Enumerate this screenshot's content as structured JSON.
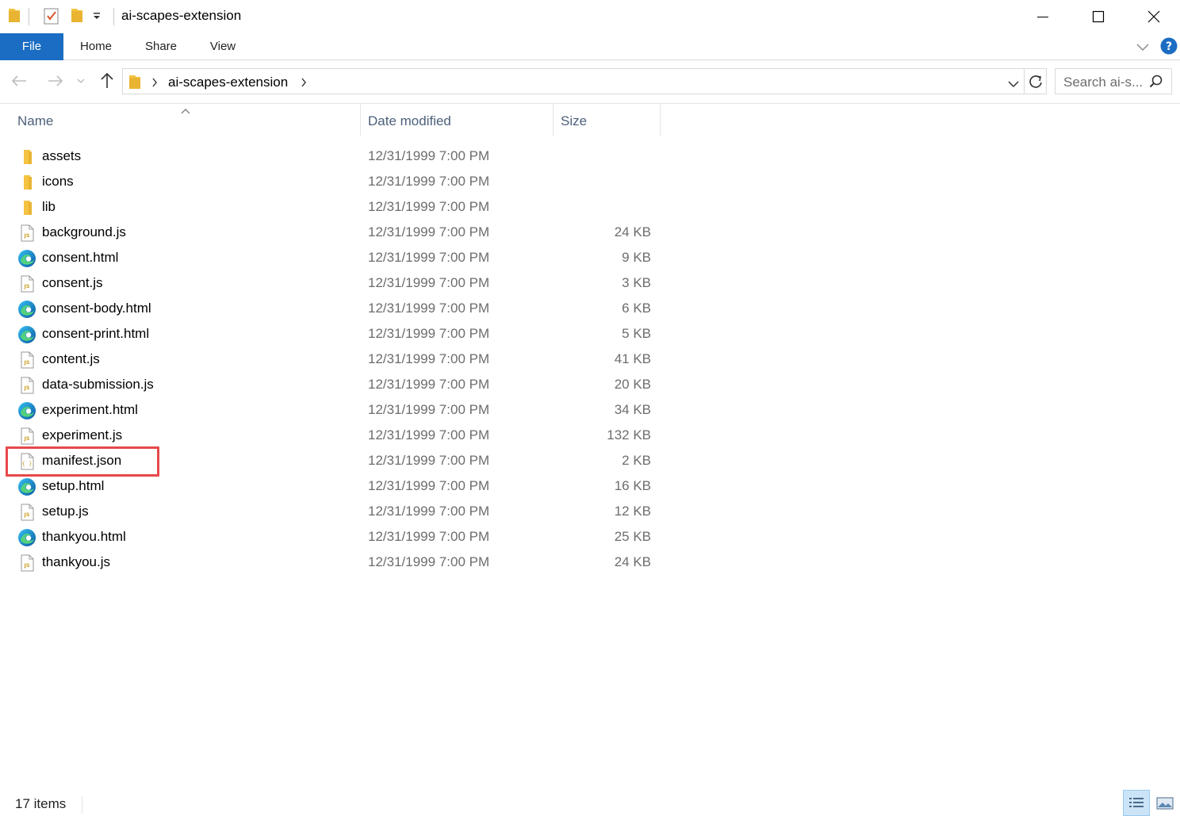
{
  "window": {
    "title": "ai-scapes-extension"
  },
  "ribbon": {
    "tabs": [
      "File",
      "Home",
      "Share",
      "View"
    ]
  },
  "address": {
    "crumbs": [
      "ai-scapes-extension"
    ]
  },
  "search": {
    "placeholder": "Search ai-s..."
  },
  "columns": {
    "name": "Name",
    "date": "Date modified",
    "size": "Size"
  },
  "files": [
    {
      "name": "assets",
      "date": "12/31/1999 7:00 PM",
      "size": "",
      "type": "folder"
    },
    {
      "name": "icons",
      "date": "12/31/1999 7:00 PM",
      "size": "",
      "type": "folder"
    },
    {
      "name": "lib",
      "date": "12/31/1999 7:00 PM",
      "size": "",
      "type": "folder"
    },
    {
      "name": "background.js",
      "date": "12/31/1999 7:00 PM",
      "size": "24 KB",
      "type": "js"
    },
    {
      "name": "consent.html",
      "date": "12/31/1999 7:00 PM",
      "size": "9 KB",
      "type": "edge"
    },
    {
      "name": "consent.js",
      "date": "12/31/1999 7:00 PM",
      "size": "3 KB",
      "type": "js"
    },
    {
      "name": "consent-body.html",
      "date": "12/31/1999 7:00 PM",
      "size": "6 KB",
      "type": "edge"
    },
    {
      "name": "consent-print.html",
      "date": "12/31/1999 7:00 PM",
      "size": "5 KB",
      "type": "edge"
    },
    {
      "name": "content.js",
      "date": "12/31/1999 7:00 PM",
      "size": "41 KB",
      "type": "js"
    },
    {
      "name": "data-submission.js",
      "date": "12/31/1999 7:00 PM",
      "size": "20 KB",
      "type": "js"
    },
    {
      "name": "experiment.html",
      "date": "12/31/1999 7:00 PM",
      "size": "34 KB",
      "type": "edge"
    },
    {
      "name": "experiment.js",
      "date": "12/31/1999 7:00 PM",
      "size": "132 KB",
      "type": "js"
    },
    {
      "name": "manifest.json",
      "date": "12/31/1999 7:00 PM",
      "size": "2 KB",
      "type": "json"
    },
    {
      "name": "setup.html",
      "date": "12/31/1999 7:00 PM",
      "size": "16 KB",
      "type": "edge"
    },
    {
      "name": "setup.js",
      "date": "12/31/1999 7:00 PM",
      "size": "12 KB",
      "type": "js"
    },
    {
      "name": "thankyou.html",
      "date": "12/31/1999 7:00 PM",
      "size": "25 KB",
      "type": "edge"
    },
    {
      "name": "thankyou.js",
      "date": "12/31/1999 7:00 PM",
      "size": "24 KB",
      "type": "js"
    }
  ],
  "highlighted_file": "manifest.json",
  "status": {
    "item_count": "17 items"
  },
  "colors": {
    "file_tab": "#1a6dc2",
    "folder": "#f5c342",
    "highlight": "#e8484a",
    "edge": "#0c7bd4"
  }
}
